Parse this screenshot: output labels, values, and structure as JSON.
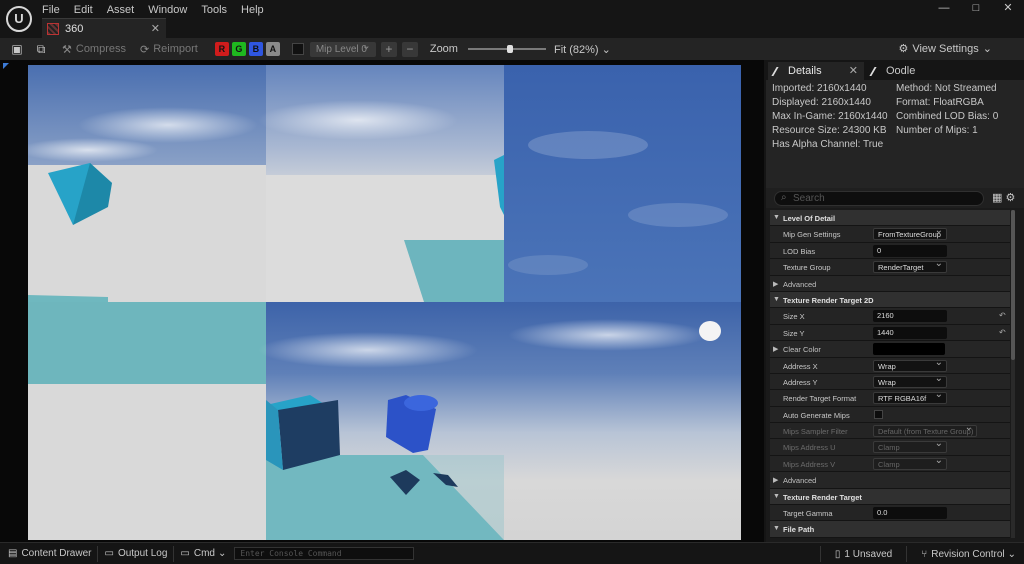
{
  "app": {
    "logo_text": "U",
    "menu": [
      "File",
      "Edit",
      "Asset",
      "Window",
      "Tools",
      "Help"
    ],
    "document_tab": "360",
    "window_controls": {
      "minimize": "—",
      "maximize": "□",
      "close": "✕"
    }
  },
  "toolbar": {
    "save_icon": "save-icon",
    "browse_icon": "browse-icon",
    "compress_label": "Compress",
    "reimport_label": "Reimport",
    "channels": [
      {
        "label": "R",
        "color": "#d01c1c"
      },
      {
        "label": "G",
        "color": "#1fb81f"
      },
      {
        "label": "B",
        "color": "#2f56e0"
      },
      {
        "label": "A",
        "color": "#8a8a8a"
      }
    ],
    "mip_level": "Mip Level 0",
    "zoom_label": "Zoom",
    "zoom_position": 0.5,
    "fit_label": "Fit (82%)",
    "view_settings_label": "View Settings"
  },
  "panel": {
    "details_tab": "Details",
    "oodle_tab": "Oodle",
    "info_left": [
      "Imported: 2160x1440",
      "Displayed: 2160x1440",
      "Max In-Game: 2160x1440",
      "Resource Size: 24300 KB",
      "Has Alpha Channel: True"
    ],
    "info_right": [
      "Method: Not Streamed",
      "Format: FloatRGBA",
      "Combined LOD Bias: 0",
      "Number of Mips: 1"
    ],
    "search_placeholder": "Search",
    "rows": [
      {
        "type": "cat",
        "label": "Level Of Detail"
      },
      {
        "type": "prop",
        "label": "Mip Gen Settings",
        "value": "FromTextureGroup",
        "kind": "dd"
      },
      {
        "type": "prop",
        "label": "LOD Bias",
        "value": "0",
        "kind": "num"
      },
      {
        "type": "prop",
        "label": "Texture Group",
        "value": "RenderTarget",
        "kind": "dd"
      },
      {
        "type": "sub",
        "label": "Advanced"
      },
      {
        "type": "cat",
        "label": "Texture Render Target 2D"
      },
      {
        "type": "prop",
        "label": "Size X",
        "value": "2160",
        "kind": "num",
        "reset": true
      },
      {
        "type": "prop",
        "label": "Size Y",
        "value": "1440",
        "kind": "num",
        "reset": true
      },
      {
        "type": "sub",
        "label": "Clear Color",
        "kind": "color"
      },
      {
        "type": "prop",
        "label": "Address X",
        "value": "Wrap",
        "kind": "dd"
      },
      {
        "type": "prop",
        "label": "Address Y",
        "value": "Wrap",
        "kind": "dd"
      },
      {
        "type": "prop",
        "label": "Render Target Format",
        "value": "RTF RGBA16f",
        "kind": "dd"
      },
      {
        "type": "prop",
        "label": "Auto Generate Mips",
        "kind": "check"
      },
      {
        "type": "prop",
        "label": "Mips Sampler Filter",
        "value": "Default (from Texture Group)",
        "kind": "dd",
        "disabled": true
      },
      {
        "type": "prop",
        "label": "Mips Address U",
        "value": "Clamp",
        "kind": "dd",
        "disabled": true
      },
      {
        "type": "prop",
        "label": "Mips Address V",
        "value": "Clamp",
        "kind": "dd",
        "disabled": true
      },
      {
        "type": "sub",
        "label": "Advanced"
      },
      {
        "type": "cat",
        "label": "Texture Render Target"
      },
      {
        "type": "prop",
        "label": "Target Gamma",
        "value": "0.0",
        "kind": "num"
      },
      {
        "type": "cat",
        "label": "File Path"
      }
    ]
  },
  "statusbar": {
    "content_drawer": "Content Drawer",
    "output_log": "Output Log",
    "cmd": "Cmd",
    "console_placeholder": "Enter Console Command",
    "unsaved": "1 Unsaved",
    "revision_control": "Revision Control"
  }
}
